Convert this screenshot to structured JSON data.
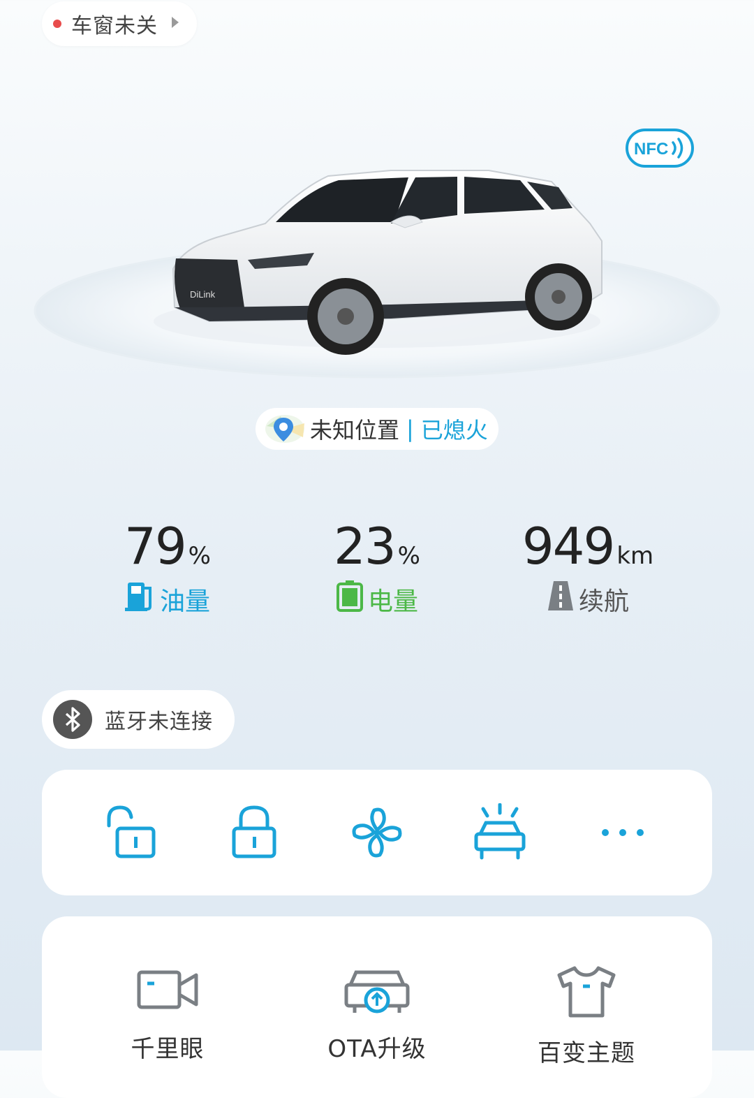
{
  "status": {
    "text": "车窗未关",
    "dot_color": "#e84c4c"
  },
  "nfc": {
    "label": "NFC"
  },
  "location": {
    "place": "未知位置",
    "separator": "|",
    "engine_state": "已熄火"
  },
  "stats": [
    {
      "value": "79",
      "unit": "%",
      "label": "油量",
      "color": "#1aa3d9",
      "icon": "fuel-icon"
    },
    {
      "value": "23",
      "unit": "%",
      "label": "电量",
      "color": "#4cb847",
      "icon": "battery-icon"
    },
    {
      "value": "949",
      "unit": "km",
      "label": "续航",
      "color": "#555555",
      "icon": "road-icon"
    }
  ],
  "bluetooth": {
    "text": "蓝牙未连接"
  },
  "controls": [
    "unlock-icon",
    "lock-icon",
    "fan-icon",
    "car-lights-icon",
    "more-icon"
  ],
  "features": [
    {
      "label": "千里眼",
      "icon": "camera-icon"
    },
    {
      "label": "OTA升级",
      "icon": "ota-icon"
    },
    {
      "label": "百变主题",
      "icon": "theme-icon"
    }
  ],
  "colors": {
    "accent": "#1aa3d9",
    "green": "#4cb847"
  }
}
